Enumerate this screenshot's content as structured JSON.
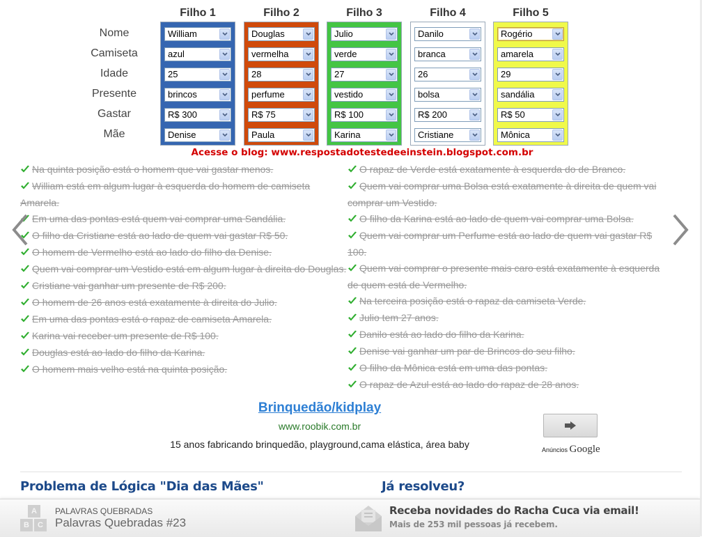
{
  "grid": {
    "row_labels": [
      "Nome",
      "Camiseta",
      "Idade",
      "Presente",
      "Gastar",
      "Mãe"
    ],
    "columns": [
      {
        "header": "Filho 1",
        "color": "#3566b1",
        "values": [
          "William",
          "azul",
          "25",
          "brincos",
          "R$ 300",
          "Denise"
        ]
      },
      {
        "header": "Filho 2",
        "color": "#d04a0b",
        "values": [
          "Douglas",
          "vermelha",
          "28",
          "perfume",
          "R$ 75",
          "Paula"
        ]
      },
      {
        "header": "Filho 3",
        "color": "#44c544",
        "values": [
          "Julio",
          "verde",
          "27",
          "vestido",
          "R$ 100",
          "Karina"
        ]
      },
      {
        "header": "Filho 4",
        "color": "#ffffff",
        "values": [
          "Danilo",
          "branca",
          "26",
          "bolsa",
          "R$ 200",
          "Cristiane"
        ]
      },
      {
        "header": "Filho 5",
        "color": "#f0f94a",
        "values": [
          "Rogério",
          "amarela",
          "29",
          "sandália",
          "R$ 50",
          "Mônica"
        ]
      }
    ]
  },
  "blog_link": "Acesse o blog: www.respostadotestedeeinstein.blogspot.com.br",
  "clues_left": [
    "Na quinta posição está o homem que vai gastar menos.",
    "William está em algum lugar à esquerda do homem de camiseta Amarela.",
    "Em uma das pontas está quem vai comprar uma Sandália.",
    "O filho da Cristiane está ao lado de quem vai gastar R$ 50.",
    "O homem de Vermelho está ao lado do filho da Denise.",
    "Quem vai comprar um Vestido está em algum lugar à direita do Douglas.",
    "Cristiane vai ganhar um presente de R$ 200.",
    "O homem de 26 anos está exatamente à direita do Julio.",
    "Em uma das pontas está o rapaz de camiseta Amarela.",
    "Karina vai receber um presente de R$ 100.",
    "Douglas está ao lado do filho da Karina.",
    "O homem mais velho está na quinta posição."
  ],
  "clues_right": [
    "O rapaz de Verde está exatamente à esquerda do de Branco.",
    "Quem vai comprar uma Bolsa está exatamente à direita de quem vai comprar um Vestido.",
    "O filho da Karina está ao lado de quem vai comprar uma Bolsa.",
    "Quem vai comprar um Perfume está ao lado de quem vai gastar R$ 100.",
    "Quem vai comprar o presente mais caro está exatamente à esquerda de quem está de Vermelho.",
    "Na terceira posição está o rapaz da camiseta Verde.",
    "Julio tem 27 anos.",
    "Danilo está ao lado do filho da Karina.",
    "Denise vai ganhar um par de Brincos do seu filho.",
    "O filho da Mônica está em uma das pontas.",
    "O rapaz de Azul está ao lado do rapaz de 28 anos."
  ],
  "ad": {
    "title": "Brinquedão/kidplay",
    "url": "www.roobik.com.br",
    "description": "15 anos fabricando brinquedão, playground,cama elástica, área baby",
    "choices_label": "Anúncios",
    "choices_brand": "Google"
  },
  "sections": {
    "left_title": "Problema de Lógica \"Dia das Mães\"",
    "right_title": "Já resolveu?"
  },
  "bottom_bar": {
    "abc_letters": [
      "A",
      "B",
      "C"
    ],
    "category": "PALAVRAS QUEBRADAS",
    "game_title": "Palavras Quebradas #23",
    "newsletter_title": "Receba novidades do Racha Cuca via email!",
    "newsletter_sub": "Mais de 253 mil pessoas já recebem."
  }
}
